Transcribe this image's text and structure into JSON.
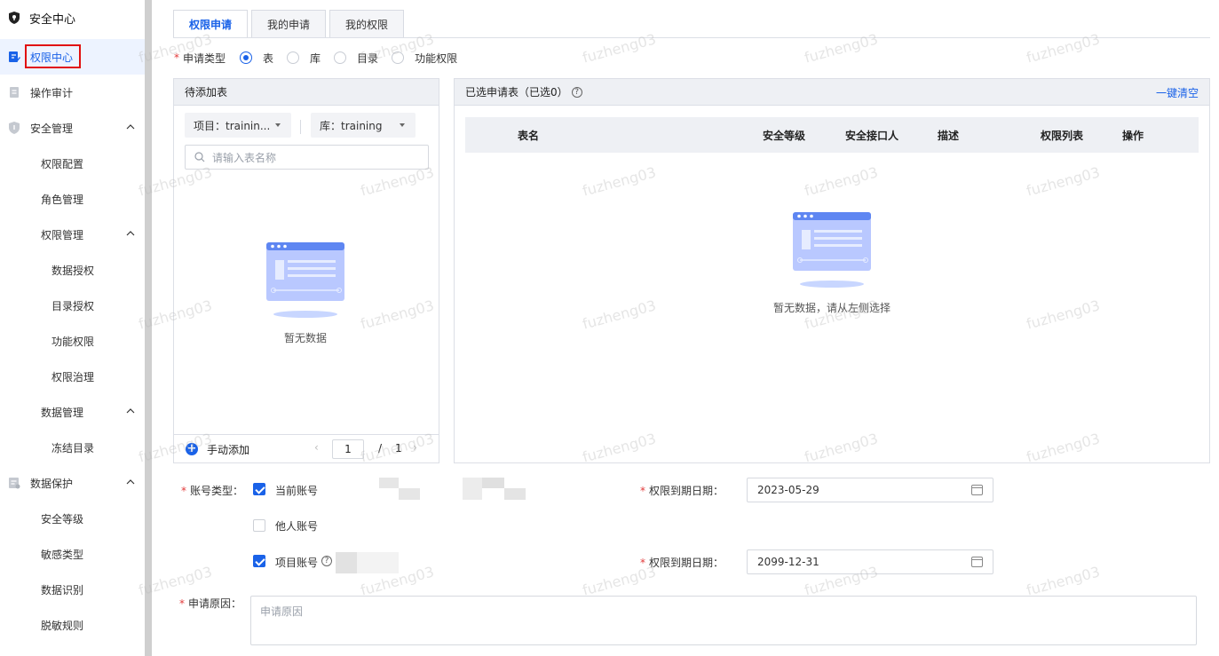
{
  "sidebar": {
    "title": "安全中心",
    "items": [
      {
        "label": "权限中心",
        "icon": "edit-icon",
        "active": true
      },
      {
        "label": "操作审计",
        "icon": "document-icon"
      },
      {
        "label": "安全管理",
        "icon": "shield-icon",
        "expanded": true
      },
      {
        "label": "权限配置"
      },
      {
        "label": "角色管理"
      },
      {
        "label": "权限管理",
        "expanded": true
      },
      {
        "label": "数据授权"
      },
      {
        "label": "目录授权"
      },
      {
        "label": "功能权限"
      },
      {
        "label": "权限治理"
      },
      {
        "label": "数据管理",
        "expanded": true
      },
      {
        "label": "冻结目录"
      },
      {
        "label": "数据保护",
        "icon": "data-protect-icon",
        "expanded": true
      },
      {
        "label": "安全等级"
      },
      {
        "label": "敏感类型"
      },
      {
        "label": "数据识别"
      },
      {
        "label": "脱敏规则"
      }
    ]
  },
  "tabs": [
    "权限申请",
    "我的申请",
    "我的权限"
  ],
  "apply_type": {
    "label": "申请类型",
    "options": [
      "表",
      "库",
      "目录",
      "功能权限"
    ],
    "selected": "表"
  },
  "left_panel": {
    "title": "待添加表",
    "project_select": "项目：trainin...",
    "db_select": "库：training",
    "search_placeholder": "请输入表名称",
    "empty_text": "暂无数据",
    "manual_add": "手动添加",
    "page_current": "1",
    "page_sep": "/",
    "page_total": "1"
  },
  "right_panel": {
    "title": "已选申请表（已选0）",
    "clear_label": "一键清空",
    "columns": [
      "表名",
      "安全等级",
      "安全接口人",
      "描述",
      "权限列表",
      "操作"
    ],
    "empty_text": "暂无数据，请从左侧选择"
  },
  "form": {
    "account_type_label": "账号类型：",
    "current_account": "当前账号",
    "other_account": "他人账号",
    "project_account": "项目账号",
    "expire_label_1": "权限到期日期：",
    "expire_date_1": "2023-05-29",
    "expire_label_2": "权限到期日期：",
    "expire_date_2": "2099-12-31",
    "reason_label": "申请原因：",
    "reason_placeholder": "申请原因"
  },
  "watermark": "fuzheng03",
  "colors": {
    "accent": "#1a62e8",
    "required": "#e23b3b",
    "highlight_box": "#e10f0f"
  }
}
